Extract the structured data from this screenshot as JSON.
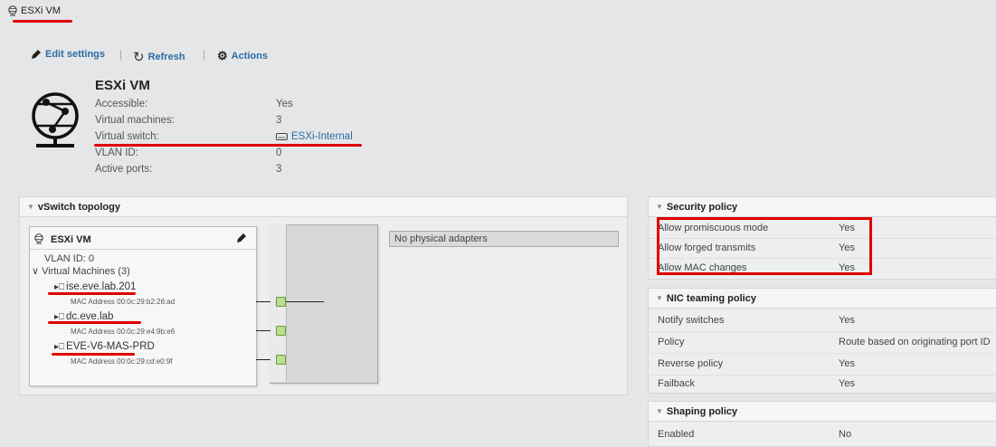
{
  "window": {
    "title": "ESXi VM"
  },
  "toolbar": {
    "edit_settings": "Edit settings",
    "refresh": "Refresh",
    "actions": "Actions",
    "separator": "|"
  },
  "header": {
    "name": "ESXi VM",
    "fields": [
      {
        "label": "Accessible:",
        "value": "Yes"
      },
      {
        "label": "Virtual machines:",
        "value": "3"
      },
      {
        "label": "Virtual switch:",
        "value": "ESXi-Internal"
      },
      {
        "label": "VLAN ID:",
        "value": "0"
      },
      {
        "label": "Active ports:",
        "value": "3"
      }
    ]
  },
  "topology": {
    "title": "vSwitch topology",
    "portgroup": {
      "name": "ESXi VM",
      "vlan": "VLAN ID: 0",
      "vm_group": "Virtual Machines (3)",
      "vms": [
        {
          "name": "ise.eve.lab.201",
          "mac": "MAC Address 00:0c:29:b2:26:ad"
        },
        {
          "name": "dc.eve.lab",
          "mac": "MAC Address 00:0c:29:e4:9b:e6"
        },
        {
          "name": "EVE-V6-MAS-PRD",
          "mac": "MAC Address 00:0c:29:cd:e0:9f"
        }
      ]
    },
    "physical_adapters": "No physical adapters"
  },
  "security_policy": {
    "title": "Security policy",
    "rows": [
      {
        "label": "Allow promiscuous mode",
        "value": "Yes"
      },
      {
        "label": "Allow forged transmits",
        "value": "Yes"
      },
      {
        "label": "Allow MAC changes",
        "value": "Yes"
      }
    ]
  },
  "nic_teaming_policy": {
    "title": "NIC teaming policy",
    "rows": [
      {
        "label": "Notify switches",
        "value": "Yes"
      },
      {
        "label": "Policy",
        "value": "Route based on originating port ID"
      },
      {
        "label": "Reverse policy",
        "value": "Yes"
      },
      {
        "label": "Failback",
        "value": "Yes"
      }
    ]
  },
  "shaping_policy": {
    "title": "Shaping policy",
    "rows": [
      {
        "label": "Enabled",
        "value": "No"
      }
    ]
  },
  "colors": {
    "link": "#2b6ca3",
    "highlight": "#e00000",
    "port": "#b8e08f"
  },
  "icons": [
    "network-icon",
    "pencil-icon",
    "refresh-icon",
    "gear-icon",
    "switch-icon",
    "vm-icon",
    "chevron-down-icon"
  ]
}
